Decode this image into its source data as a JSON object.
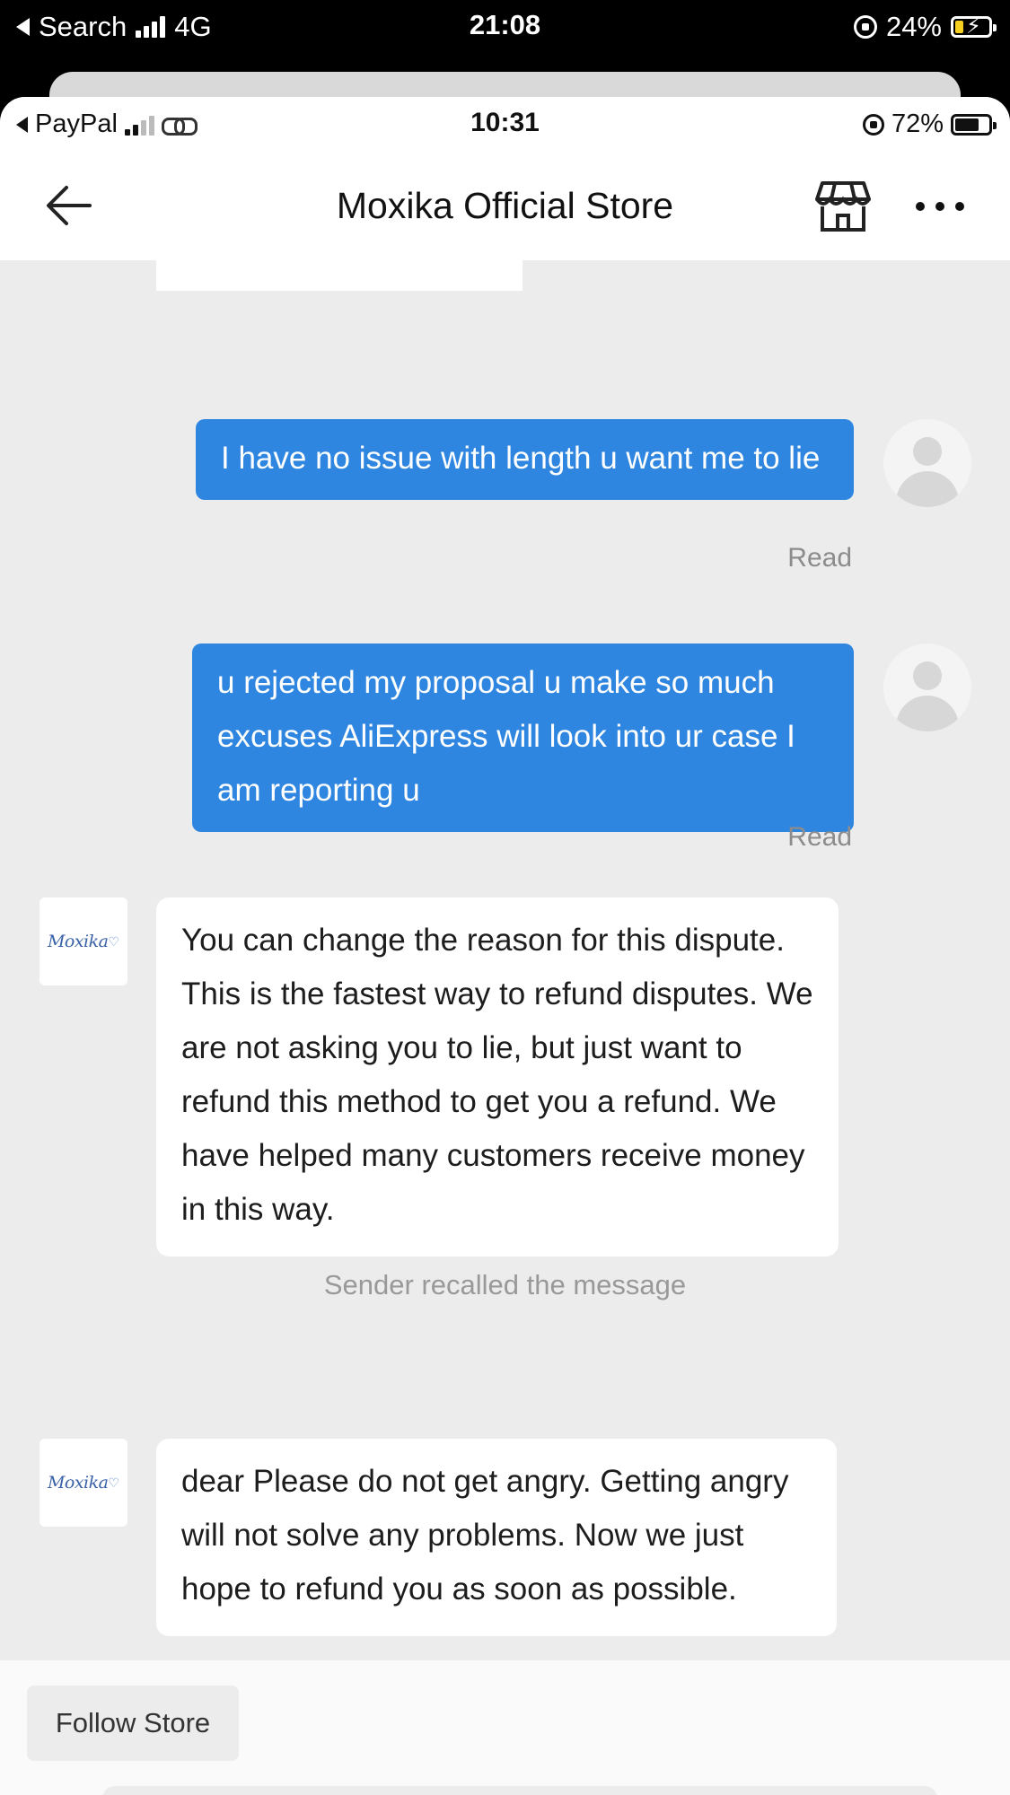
{
  "outer_status": {
    "back_label": "Search",
    "network": "4G",
    "time": "21:08",
    "battery": "24%",
    "battery_level": 0.24,
    "colors": {
      "battery_fill": "#f5d020"
    }
  },
  "inner_status": {
    "back_label": "PayPal",
    "time": "10:31",
    "battery": "72%",
    "battery_level": 0.72
  },
  "header": {
    "title": "Moxika Official Store",
    "back_icon": "arrow-left-icon",
    "store_icon": "storefront-icon",
    "more_icon": "more-horizontal-icon"
  },
  "messages": {
    "out_1": "I have no issue with length u want me to lie",
    "out_1_status": "Read",
    "out_2": "u rejected my proposal u make so much excuses AliExpress will look into ur case I am reporting u",
    "out_2_status": "Read",
    "in_1": "You can change the reason for this dispute. This is the fastest way to refund disputes. We are not asking you to lie, but just want to refund this method to get you a refund. We have helped many customers receive money in this way.",
    "system_1": "Sender recalled the message",
    "in_2": "dear Please do not get angry. Getting angry will not solve any problems. Now we just hope to refund you as soon as possible."
  },
  "store_avatar": {
    "logo_text": "Moxika"
  },
  "bottom": {
    "follow_label": "Follow Store"
  },
  "colors": {
    "outgoing_bubble": "#2f86e0",
    "incoming_bubble": "#ffffff",
    "chat_background": "#ececec"
  }
}
